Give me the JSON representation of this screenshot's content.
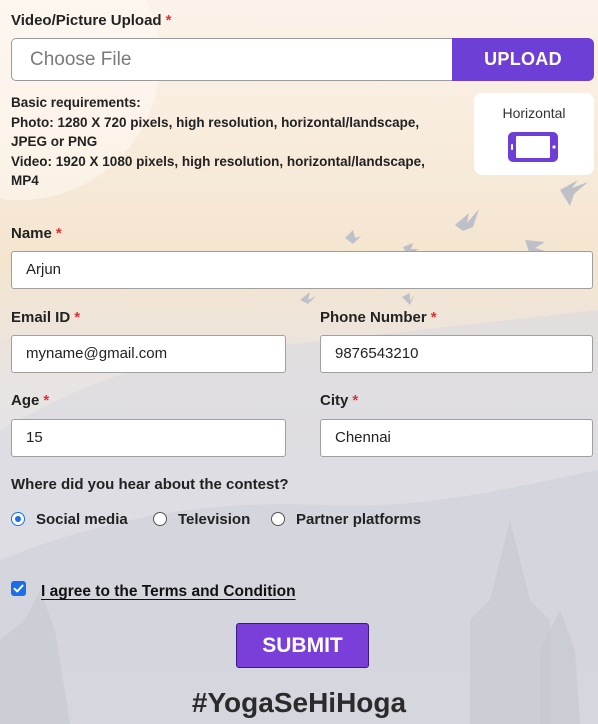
{
  "upload": {
    "label": "Video/Picture Upload",
    "required_mark": "*",
    "file_placeholder": "Choose File",
    "button": "UPLOAD",
    "requirements": [
      "Basic requirements:",
      "Photo: 1280 X 720 pixels, high resolution, horizontal/landscape,",
      "JPEG or PNG",
      "Video: 1920 X 1080 pixels, high resolution, horizontal/landscape,",
      "MP4"
    ],
    "orientation_label": "Horizontal",
    "orientation_icon": "phone-landscape-icon"
  },
  "form": {
    "name": {
      "label": "Name",
      "required_mark": "*",
      "value": "Arjun"
    },
    "email": {
      "label": "Email ID",
      "required_mark": "*",
      "value": "myname@gmail.com"
    },
    "phone": {
      "label": "Phone Number",
      "required_mark": "*",
      "value": "9876543210"
    },
    "age": {
      "label": "Age",
      "required_mark": "*",
      "value": "15"
    },
    "city": {
      "label": "City",
      "required_mark": "*",
      "value": "Chennai"
    }
  },
  "source": {
    "question": "Where did you hear about the contest?",
    "options": [
      "Social media",
      "Television",
      "Partner platforms"
    ],
    "selected": "Social media"
  },
  "terms": {
    "label": "I agree to the Terms and Condition",
    "checked": true
  },
  "submit_label": "SUBMIT",
  "hashtag": "#YogaSeHiHoga",
  "colors": {
    "accent": "#6e3fd6",
    "required": "#e03131",
    "radio": "#1a6ee8"
  }
}
